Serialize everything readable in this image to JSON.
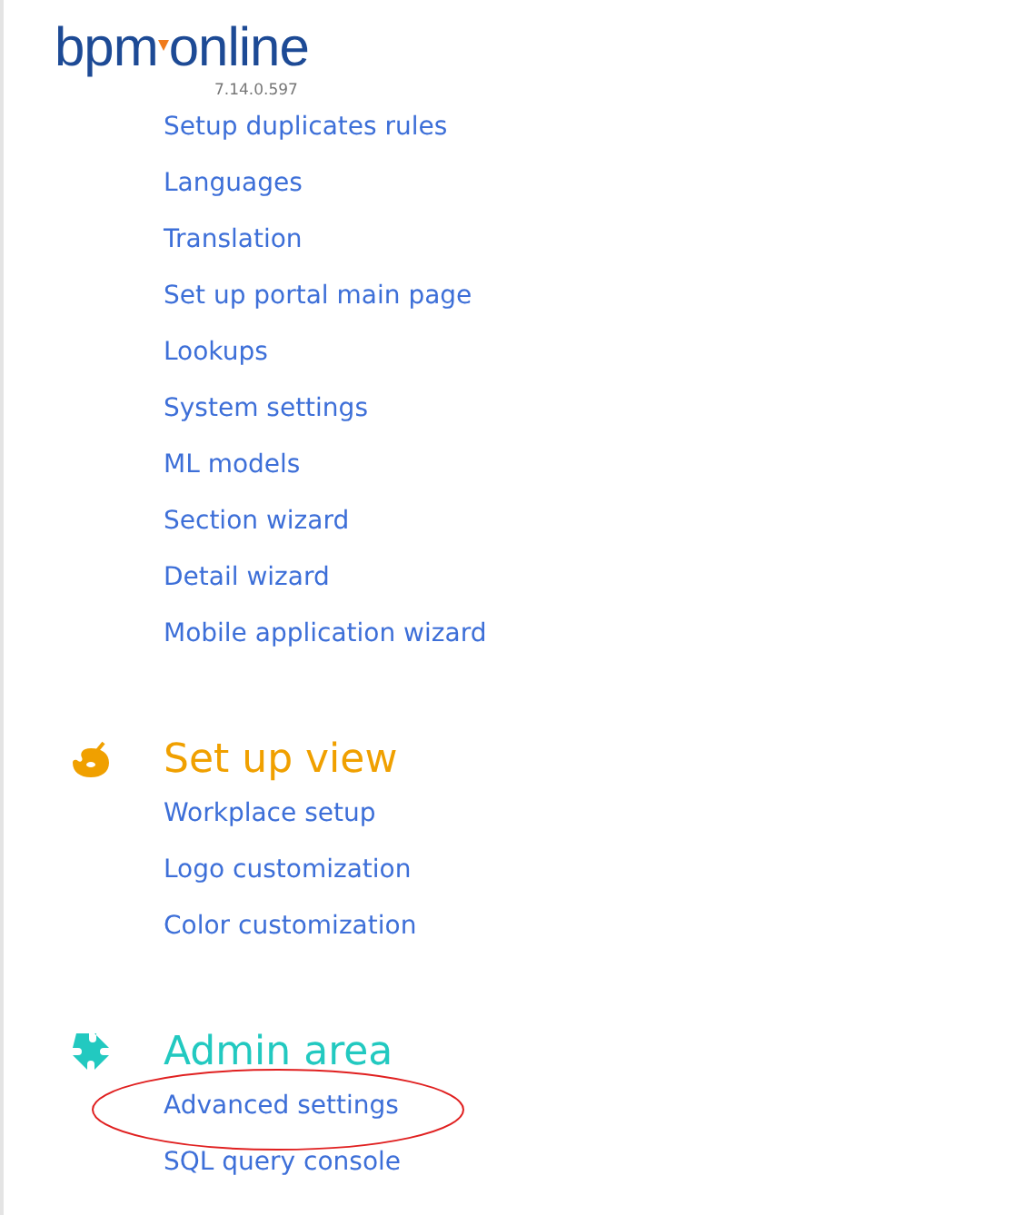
{
  "logo": {
    "left": "bpm",
    "right": "online"
  },
  "version": "7.14.0.597",
  "sections": [
    {
      "items": [
        {
          "label": "Setup duplicates rules",
          "highlighted": false
        },
        {
          "label": "Languages",
          "highlighted": false
        },
        {
          "label": "Translation",
          "highlighted": false
        },
        {
          "label": "Set up portal main page",
          "highlighted": false
        },
        {
          "label": "Lookups",
          "highlighted": false
        },
        {
          "label": "System settings",
          "highlighted": false
        },
        {
          "label": "ML models",
          "highlighted": false
        },
        {
          "label": "Section wizard",
          "highlighted": false
        },
        {
          "label": "Detail wizard",
          "highlighted": false
        },
        {
          "label": "Mobile application wizard",
          "highlighted": false
        }
      ]
    },
    {
      "title": "Set up view",
      "kind": "palette",
      "color": "#f0a000",
      "items": [
        {
          "label": "Workplace setup",
          "highlighted": false
        },
        {
          "label": "Logo customization",
          "highlighted": false
        },
        {
          "label": "Color customization",
          "highlighted": false
        }
      ]
    },
    {
      "title": "Admin area",
      "kind": "puzzle",
      "color": "#22c9c0",
      "items": [
        {
          "label": "Advanced settings",
          "highlighted": true
        },
        {
          "label": "SQL query console",
          "highlighted": false
        }
      ]
    }
  ]
}
